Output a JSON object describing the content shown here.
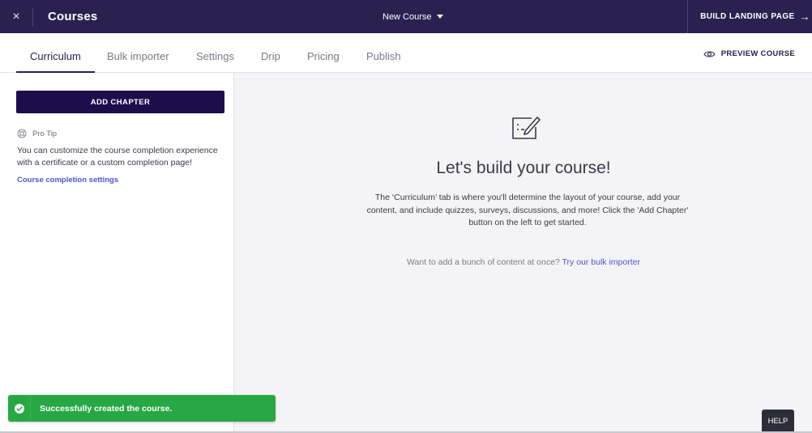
{
  "topbar": {
    "close_icon": "×",
    "title": "Courses",
    "course_selector": "New Course",
    "build_landing": "BUILD LANDING PAGE",
    "arrow_icon": "→"
  },
  "tabs": [
    {
      "label": "Curriculum",
      "active": true
    },
    {
      "label": "Bulk importer",
      "active": false
    },
    {
      "label": "Settings",
      "active": false
    },
    {
      "label": "Drip",
      "active": false
    },
    {
      "label": "Pricing",
      "active": false
    },
    {
      "label": "Publish",
      "active": false
    }
  ],
  "preview_label": "PREVIEW COURSE",
  "sidebar": {
    "add_chapter": "ADD CHAPTER",
    "protip_label": "Pro Tip",
    "protip_text": "You can customize the course completion experience with a certificate or a custom completion page!",
    "completion_link": "Course completion settings"
  },
  "main": {
    "title": "Let's build your course!",
    "description": "The ‘Curriculum’ tab is where you'll determine the layout of your course, add your content, and include quizzes, surveys, discussions, and more! Click the 'Add Chapter' button on the left to get started.",
    "bulk_prompt": "Want to add a bunch of content at once?",
    "bulk_link": "Try our bulk importer"
  },
  "toast": {
    "message": "Successfully created the course."
  },
  "help_label": "HELP",
  "colors": {
    "topbar": "#2a2151",
    "primary_button": "#1e0c4b",
    "link": "#4b55c8",
    "success": "#28a745"
  }
}
